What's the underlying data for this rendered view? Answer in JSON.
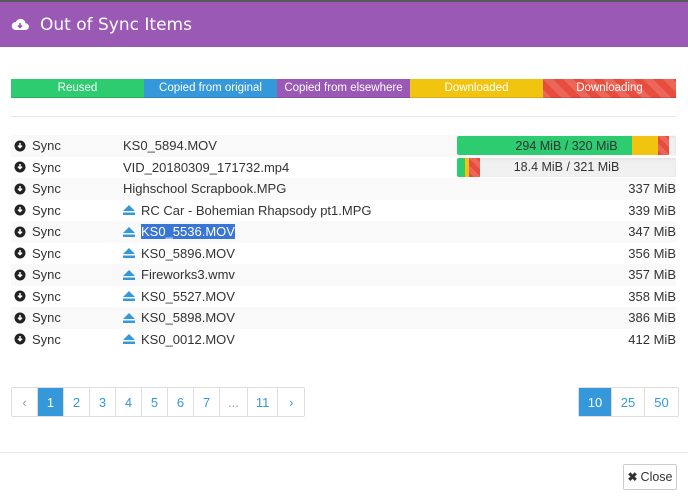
{
  "header": {
    "title": "Out of Sync Items",
    "icon": "cloud-download-icon"
  },
  "legend": [
    {
      "label": "Reused",
      "color": "#2ecc71"
    },
    {
      "label": "Copied from original",
      "color": "#3498db"
    },
    {
      "label": "Copied from elsewhere",
      "color": "#9b59b6"
    },
    {
      "label": "Downloaded",
      "color": "#f1c40f"
    },
    {
      "label": "Downloading",
      "color": "#e74c3c"
    }
  ],
  "rows": [
    {
      "action": "Sync",
      "name": "KS0_5894.MOV",
      "eject": false,
      "progress": {
        "text": "294 MiB / 320 MiB",
        "reused": 0.8,
        "downloaded": 0.12,
        "downloading": 0.05
      }
    },
    {
      "action": "Sync",
      "name": "VID_20180309_171732.mp4",
      "eject": false,
      "progress": {
        "text": "18.4 MiB / 321 MiB",
        "reused": 0.035,
        "downloaded": 0.02,
        "downloading": 0.05
      }
    },
    {
      "action": "Sync",
      "name": "Highschool Scrapbook.MPG",
      "eject": false,
      "size": "337 MiB"
    },
    {
      "action": "Sync",
      "name": "RC Car - Bohemian Rhapsody pt1.MPG",
      "eject": true,
      "size": "339 MiB"
    },
    {
      "action": "Sync",
      "name": "KS0_5536.MOV",
      "eject": true,
      "size": "347 MiB",
      "selected": true
    },
    {
      "action": "Sync",
      "name": "KS0_5896.MOV",
      "eject": true,
      "size": "356 MiB"
    },
    {
      "action": "Sync",
      "name": "Fireworks3.wmv",
      "eject": true,
      "size": "357 MiB"
    },
    {
      "action": "Sync",
      "name": "KS0_5527.MOV",
      "eject": true,
      "size": "358 MiB"
    },
    {
      "action": "Sync",
      "name": "KS0_5898.MOV",
      "eject": true,
      "size": "386 MiB"
    },
    {
      "action": "Sync",
      "name": "KS0_0012.MOV",
      "eject": true,
      "size": "412 MiB"
    }
  ],
  "pagination": {
    "prev": "‹",
    "pages": [
      "1",
      "2",
      "3",
      "4",
      "5",
      "6",
      "7",
      "...",
      "11"
    ],
    "current": "1",
    "next": "›"
  },
  "page_sizes": {
    "options": [
      "10",
      "25",
      "50"
    ],
    "selected": "10"
  },
  "footer": {
    "close_label": "Close"
  }
}
